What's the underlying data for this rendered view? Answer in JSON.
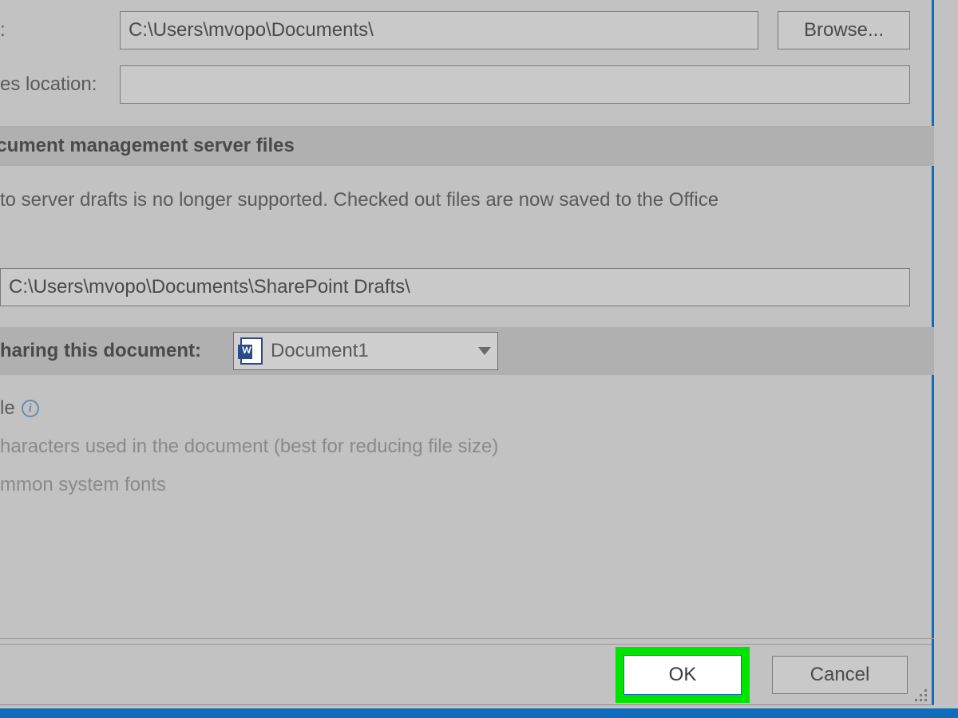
{
  "fileLocation": {
    "label_fragment": ":",
    "value": "C:\\Users\\mvopo\\Documents\\",
    "browse_label": "Browse..."
  },
  "templatesLocation": {
    "label_fragment": "es location:",
    "value": ""
  },
  "serverFiles": {
    "header_fragment": "r document management server files",
    "note_line1_fragment": "to server drafts is no longer supported. Checked out files are now saved to the Office",
    "drafts_path": "C:\\Users\\mvopo\\Documents\\SharePoint Drafts\\"
  },
  "sharing": {
    "header_fragment": "haring this document:",
    "selected_document": "Document1"
  },
  "embed": {
    "line1_fragment": "le",
    "line2_fragment": "haracters used in the document (best for reducing file size)",
    "line3_fragment": "mmon system fonts"
  },
  "footer": {
    "ok_label": "OK",
    "cancel_label": "Cancel"
  }
}
